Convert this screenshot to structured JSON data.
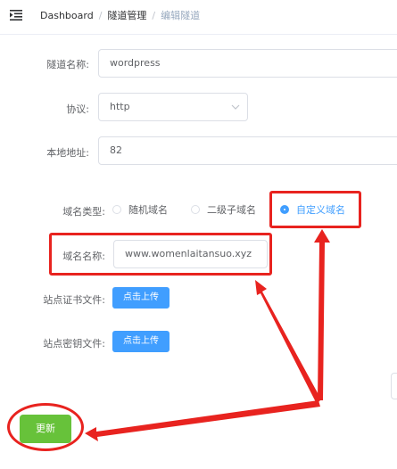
{
  "breadcrumb": {
    "items": [
      "Dashboard",
      "隧道管理",
      "编辑隧道"
    ],
    "separator": "/"
  },
  "form": {
    "tunnel_name": {
      "label": "隧道名称:",
      "value": "wordpress"
    },
    "protocol": {
      "label": "协议:",
      "value": "http"
    },
    "local_address": {
      "label": "本地地址:",
      "value": "82"
    },
    "domain_type": {
      "label": "域名类型:",
      "options": [
        "随机域名",
        "二级子域名",
        "自定义域名"
      ],
      "selected": "自定义域名"
    },
    "domain_name": {
      "label": "域名名称:",
      "value": "www.womenlaitansuo.xyz"
    },
    "cert_file": {
      "label": "站点证书文件:",
      "button": "点击上传"
    },
    "key_file": {
      "label": "站点密钥文件:",
      "button": "点击上传"
    },
    "submit": "更新"
  },
  "colors": {
    "primary": "#409eff",
    "success": "#67c23a",
    "annotation": "#e8231f"
  },
  "icons": {
    "menu_toggle": "menu-fold-icon",
    "select": "chevron-down-icon",
    "annotation": "red-arrow"
  }
}
